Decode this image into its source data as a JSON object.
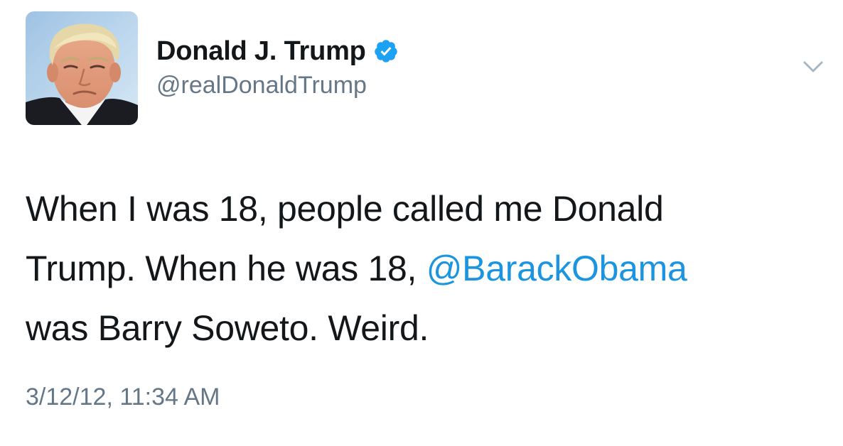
{
  "author": {
    "display_name": "Donald J. Trump",
    "handle": "@realDonaldTrump",
    "verified": true,
    "avatar_icon": "profile-photo"
  },
  "tweet": {
    "line1": "When I was 18, people called me Donald",
    "line2_before": "Trump. When he was 18, ",
    "mention": "@BarackObama",
    "line3": "was Barry Soweto. Weird.",
    "timestamp": "3/12/12, 11:34 AM"
  },
  "icons": {
    "verified": "verified-badge-icon",
    "menu": "chevron-down-icon"
  },
  "colors": {
    "text": "#14171a",
    "secondary": "#657786",
    "link": "#1b95e0",
    "verified_badge": "#1da1f2"
  }
}
